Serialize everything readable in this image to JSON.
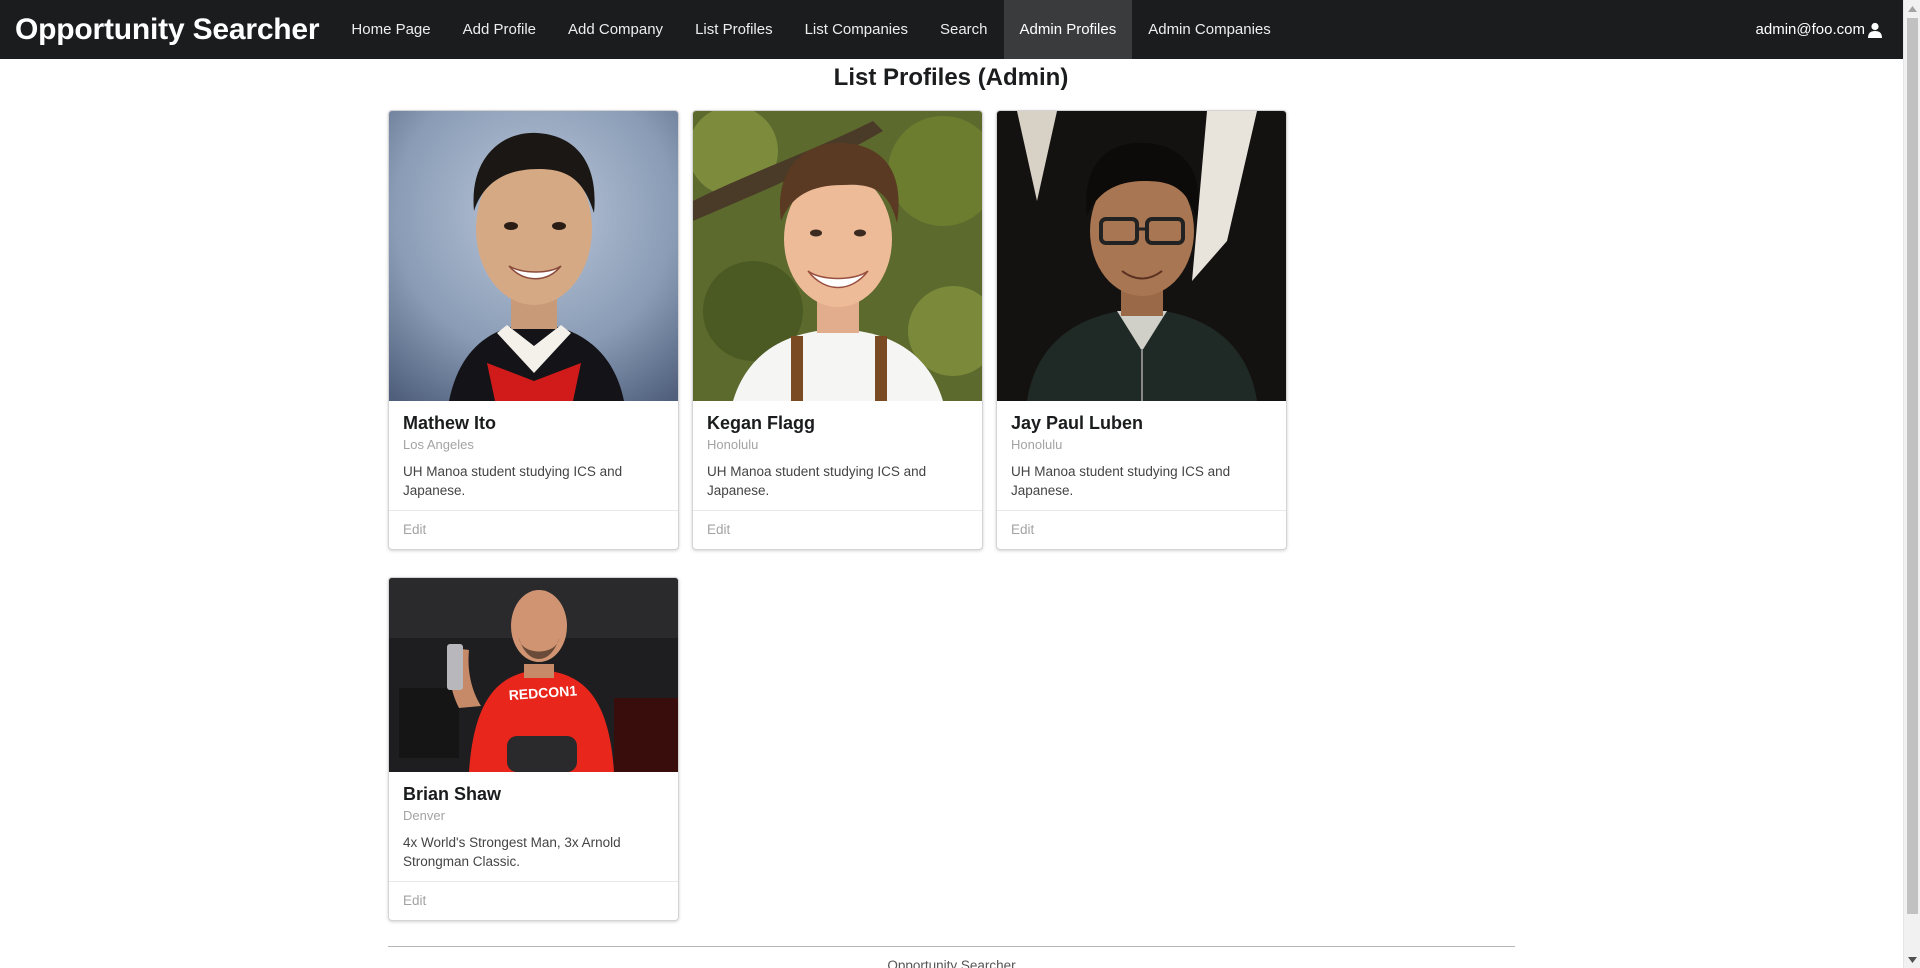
{
  "nav": {
    "brand": "Opportunity Searcher",
    "items": [
      {
        "label": "Home Page"
      },
      {
        "label": "Add Profile"
      },
      {
        "label": "Add Company"
      },
      {
        "label": "List Profiles"
      },
      {
        "label": "List Companies"
      },
      {
        "label": "Search"
      },
      {
        "label": "Admin Profiles"
      },
      {
        "label": "Admin Companies"
      }
    ],
    "active_item": "Admin Profiles",
    "user": "admin@foo.com",
    "user_icon": "user-icon"
  },
  "page": {
    "title": "List Profiles (Admin)"
  },
  "profiles": [
    {
      "name": "Mathew Ito",
      "location": "Los Angeles",
      "description": "UH Manoa student studying ICS and Japanese.",
      "action": "Edit"
    },
    {
      "name": "Kegan Flagg",
      "location": "Honolulu",
      "description": "UH Manoa student studying ICS and Japanese.",
      "action": "Edit"
    },
    {
      "name": "Jay Paul Luben",
      "location": "Honolulu",
      "description": "UH Manoa student studying ICS and Japanese.",
      "action": "Edit"
    },
    {
      "name": "Brian Shaw",
      "location": "Denver",
      "description": "4x World's Strongest Man, 3x Arnold Strongman Classic.",
      "action": "Edit"
    }
  ],
  "footer": {
    "text": "Opportunity Searcher"
  },
  "colors": {
    "navbar": "#1b1c1d",
    "active_nav": "#3a3b3c",
    "meta_text": "#a3a3a3"
  }
}
